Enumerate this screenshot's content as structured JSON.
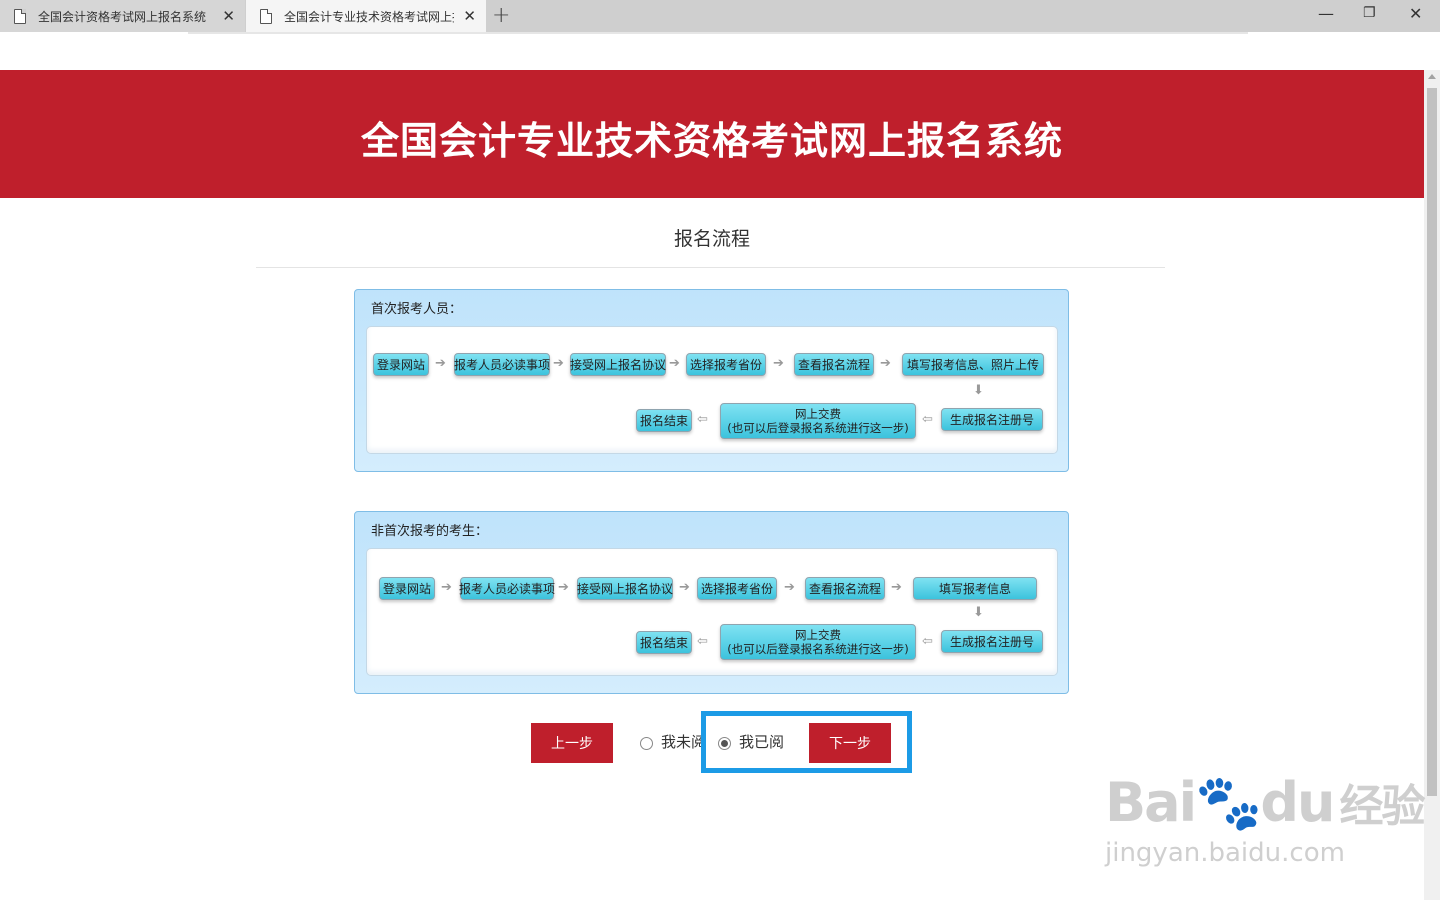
{
  "browser": {
    "tabs": [
      {
        "title": "全国会计资格考试网上报名系统",
        "active": false
      },
      {
        "title": "全国会计专业技术资格考试网上报",
        "active": true
      }
    ],
    "close_glyph": "✕",
    "new_tab_glyph": "+",
    "window_controls": {
      "minimize": "—",
      "restore": "❐",
      "close": "✕"
    }
  },
  "banner": {
    "title": "全国会计专业技术资格考试网上报名系统"
  },
  "section_title": "报名流程",
  "panels": [
    {
      "title": "首次报考人员：",
      "row1": [
        "登录网站",
        "报考人员必读事项",
        "接受网上报名协议",
        "选择报考省份",
        "查看报名流程",
        "填写报考信息、照片上传"
      ],
      "row2": {
        "end": "报名结束",
        "pay_line1": "网上交费",
        "pay_line2": "(也可以后登录报名系统进行这一步)",
        "reg": "生成报名注册号"
      }
    },
    {
      "title": "非首次报考的考生：",
      "row1": [
        "登录网站",
        "报考人员必读事项",
        "接受网上报名协议",
        "选择报考省份",
        "查看报名流程",
        "填写报考信息"
      ],
      "row2": {
        "end": "报名结束",
        "pay_line1": "网上交费",
        "pay_line2": "(也可以后登录报名系统进行这一步)",
        "reg": "生成报名注册号"
      }
    }
  ],
  "arrows": {
    "right": "➔",
    "left": "⇦",
    "down": "⬇"
  },
  "controls": {
    "prev": "上一步",
    "not_read": "我未阅",
    "read": "我已阅",
    "next": "下一步",
    "read_selected": true
  },
  "watermark": {
    "brand": "Bai",
    "brand2": "du",
    "cn": "经验",
    "url": "jingyan.baidu.com"
  },
  "colors": {
    "banner": "#bf1f2c",
    "highlight": "#1c9be6",
    "step": "#3cc3dd"
  }
}
